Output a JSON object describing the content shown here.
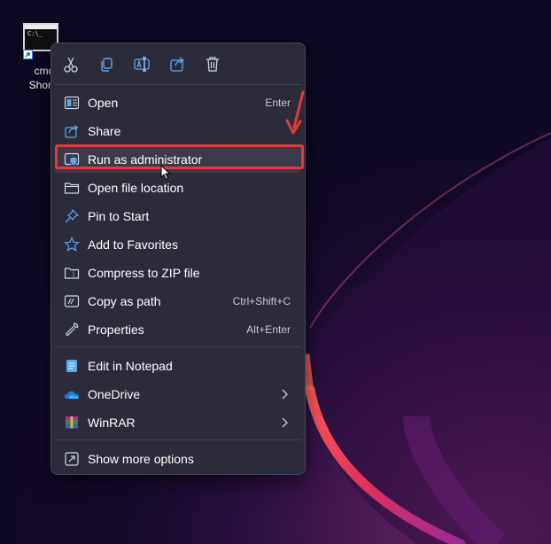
{
  "desktop": {
    "shortcut": {
      "label_line1": "cmd",
      "label_line2": "Shortc",
      "thumb_text": "C:\\_",
      "icon": "command-prompt-icon"
    }
  },
  "context_menu": {
    "toolbar": [
      {
        "name": "cut",
        "icon": "scissors-icon"
      },
      {
        "name": "copy",
        "icon": "copy-icon"
      },
      {
        "name": "rename",
        "icon": "rename-icon"
      },
      {
        "name": "share",
        "icon": "share-icon"
      },
      {
        "name": "delete",
        "icon": "trash-icon"
      }
    ],
    "items": [
      {
        "label": "Open",
        "shortcut": "Enter",
        "icon": "open-window-icon"
      },
      {
        "label": "Share",
        "icon": "share-icon"
      },
      {
        "label": "Run as administrator",
        "icon": "shield-icon",
        "highlighted": true
      },
      {
        "label": "Open file location",
        "icon": "folder-icon"
      },
      {
        "label": "Pin to Start",
        "icon": "pin-icon"
      },
      {
        "label": "Add to Favorites",
        "icon": "star-icon"
      },
      {
        "label": "Compress to ZIP file",
        "icon": "zip-folder-icon"
      },
      {
        "label": "Copy as path",
        "shortcut": "Ctrl+Shift+C",
        "icon": "copy-path-icon"
      },
      {
        "label": "Properties",
        "shortcut": "Alt+Enter",
        "icon": "wrench-icon"
      },
      {
        "label": "Edit in Notepad",
        "icon": "notepad-icon"
      },
      {
        "label": "OneDrive",
        "icon": "onedrive-cloud-icon",
        "submenu": true
      },
      {
        "label": "WinRAR",
        "icon": "winrar-icon",
        "submenu": true
      },
      {
        "label": "Show more options",
        "icon": "more-options-icon"
      }
    ]
  },
  "colors": {
    "menu_bg": "#2b2b3a",
    "accent_icon": "#5aa8f0",
    "annotation_red": "#e23b3b"
  }
}
